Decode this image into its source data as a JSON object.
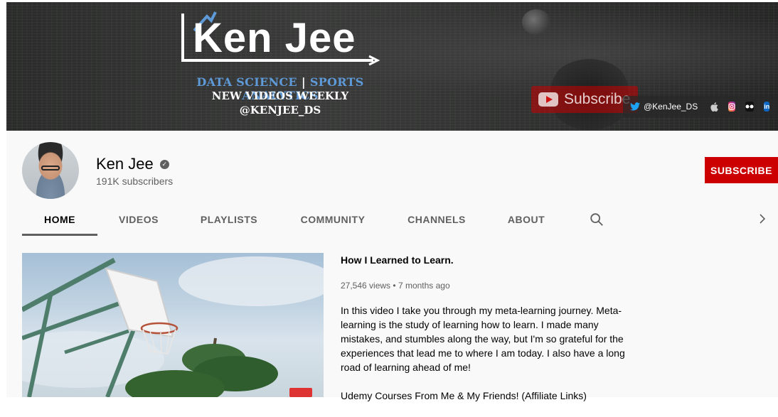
{
  "banner": {
    "logo_text": "Ken Jee",
    "tagline_part1": "DATA SCIENCE",
    "tagline_sep": "|",
    "tagline_part2": "SPORTS ANALYTICS",
    "tagline_line2": "NEW VIDEOS WEEKLY",
    "tagline_line3": "@KENJEE_DS",
    "subscribe_graphic_label": "Subscribe",
    "links": {
      "twitter_label": "@KenJee_DS",
      "icons": [
        "twitter-icon",
        "apple-icon",
        "instagram-icon",
        "flickr-icon",
        "linkedin-icon"
      ]
    }
  },
  "channel": {
    "name": "Ken Jee",
    "subscribers": "191K subscribers",
    "subscribe_label": "SUBSCRIBE",
    "subscribe_color": "#cc0000"
  },
  "tabs": [
    {
      "label": "HOME",
      "active": true
    },
    {
      "label": "VIDEOS",
      "active": false
    },
    {
      "label": "PLAYLISTS",
      "active": false
    },
    {
      "label": "COMMUNITY",
      "active": false
    },
    {
      "label": "CHANNELS",
      "active": false
    },
    {
      "label": "ABOUT",
      "active": false
    }
  ],
  "featured_video": {
    "title": "How I Learned to Learn.",
    "views": "27,546 views",
    "separator": "•",
    "age": "7 months ago",
    "description": [
      "In this video I take you through my meta-learning journey. Meta-learning is the study of learning how to learn. I made many mistakes, and stumbles along the way, but I'm so grateful for the experiences that lead me to where I am today. I also have a long road of learning ahead of me!",
      "Udemy Courses From Me & My Friends!  (Affiliate Links)"
    ]
  }
}
